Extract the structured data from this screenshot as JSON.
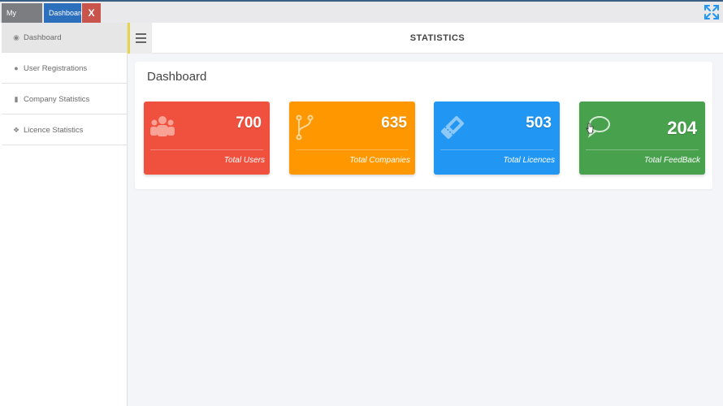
{
  "tabs": {
    "updates": "My Updates",
    "dashboard": "Dashboard",
    "close": "X"
  },
  "sidebar": {
    "items": [
      {
        "label": "Dashboard",
        "icon": "dashboard-icon"
      },
      {
        "label": "User Registrations",
        "icon": "user-icon"
      },
      {
        "label": "Company Statistics",
        "icon": "building-icon"
      },
      {
        "label": "Licence Statistics",
        "icon": "licence-icon"
      }
    ]
  },
  "header": {
    "title": "STATISTICS"
  },
  "dashboard": {
    "title": "Dashboard",
    "cards": [
      {
        "value": "700",
        "label": "Total Users",
        "color": "#f0503e",
        "icon": "users-icon"
      },
      {
        "value": "635",
        "label": "Total Companies",
        "color": "#ff9800",
        "icon": "fork-icon"
      },
      {
        "value": "503",
        "label": "Total Licences",
        "color": "#2196f3",
        "icon": "ticket-icon"
      },
      {
        "value": "204",
        "label": "Total FeedBack",
        "color": "#48a14d",
        "icon": "chat-bubble-icon"
      }
    ]
  }
}
